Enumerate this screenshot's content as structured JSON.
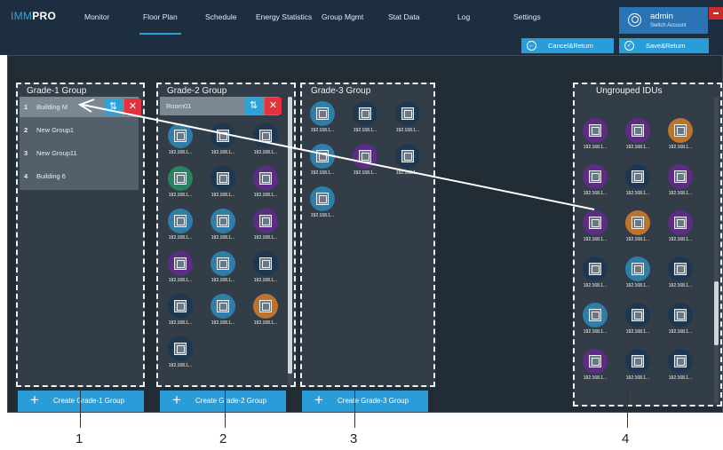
{
  "app": {
    "logo_part1": "IMM",
    "logo_part2": "PRO"
  },
  "nav": [
    {
      "label": "Monitor"
    },
    {
      "label": "Floor Plan",
      "active": true
    },
    {
      "label": "Schedule"
    },
    {
      "label": "Energy Statistics"
    },
    {
      "label": "Group Mgmt"
    },
    {
      "label": "Stat Data"
    },
    {
      "label": "Log"
    },
    {
      "label": "Settings"
    }
  ],
  "user": {
    "name": "admin",
    "switch_label": "Switch Account"
  },
  "toolbar": {
    "cancel_label": "Cancel&Return",
    "save_label": "Save&Return"
  },
  "grade1": {
    "title": "Grade-1 Group",
    "items": [
      {
        "num": "1",
        "name": "Building M"
      },
      {
        "num": "2",
        "name": "New Group1"
      },
      {
        "num": "3",
        "name": "New Group11"
      },
      {
        "num": "4",
        "name": "Building 6"
      }
    ],
    "create_label": "Create Grade-1 Group"
  },
  "grade2": {
    "title": "Grade-2 Group",
    "room": "Room01",
    "create_label": "Create Grade-2 Group",
    "ip_label": "192.168.1...",
    "idus": [
      "blue",
      "navy",
      "navy",
      "green",
      "navy",
      "purple",
      "blue",
      "blue",
      "purple",
      "purple",
      "blue",
      "navy",
      "navy",
      "blue",
      "orange",
      "navy"
    ]
  },
  "grade3": {
    "title": "Grade-3 Group",
    "create_label": "Create Grade-3 Group",
    "ip_label": "192.168.1...",
    "idus": [
      "blue",
      "navy",
      "navy",
      "blue",
      "purple",
      "navy",
      "blue"
    ]
  },
  "ungrouped": {
    "title": "Ungrouped IDUs",
    "ip_label": "192.168.1...",
    "idus": [
      "purple",
      "purple",
      "orange",
      "purple",
      "navy",
      "purple",
      "purple",
      "orange",
      "purple",
      "navy",
      "blue",
      "navy",
      "blue",
      "navy",
      "navy",
      "purple",
      "navy",
      "navy",
      "navy",
      "navy",
      "navy"
    ]
  },
  "colors": {
    "accent": "#2a9cd8",
    "delete": "#e2323d",
    "header": "#1c2e40"
  },
  "callouts": [
    "1",
    "2",
    "3",
    "4"
  ]
}
